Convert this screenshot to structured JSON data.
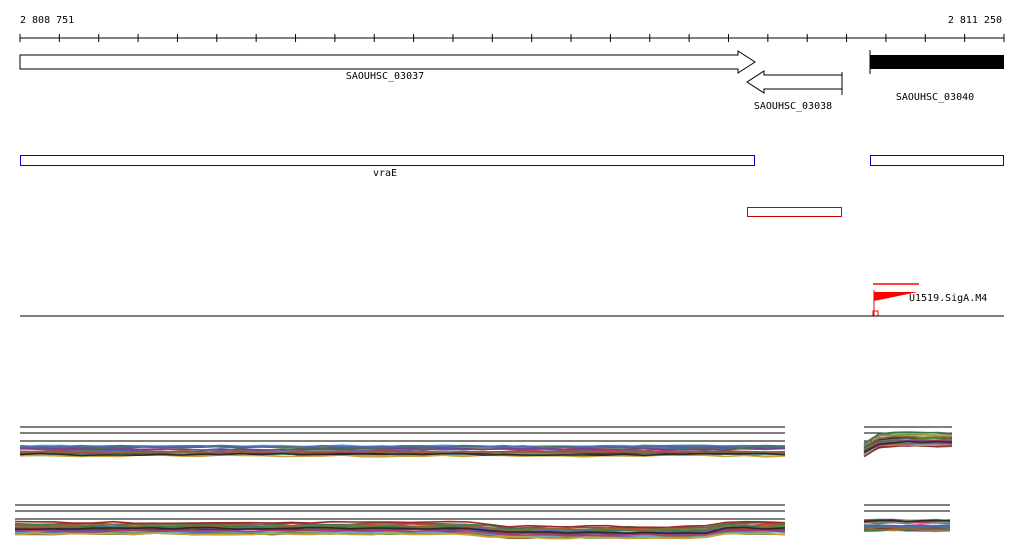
{
  "ruler": {
    "start_label": "2 808 751",
    "end_label": "2 811 250"
  },
  "genes": [
    {
      "label": "SAOUHSC_03037",
      "strand": "+",
      "style": "outline"
    },
    {
      "label": "SAOUHSC_03038",
      "strand": "-",
      "style": "outline"
    },
    {
      "label": "SAOUHSC_03040",
      "strand": "+",
      "style": "filled"
    }
  ],
  "operons": [
    {
      "label": "vraE",
      "color": "#0000cc"
    },
    {
      "label": "",
      "color": "#0000cc"
    },
    {
      "label": "",
      "color": "#cc0000"
    }
  ],
  "promoter": {
    "label": "U1519.SigA.M4",
    "color": "#ff0000"
  },
  "colors": {
    "axis": "#000000",
    "operon_blue": "#0000cc",
    "operon_red": "#cc0000",
    "promoter_red": "#ff0000",
    "expression_palette": [
      "#5fb2c8",
      "#7a9a3c",
      "#c44a2a",
      "#6a4a8c",
      "#c8a43a",
      "#3a7a4a",
      "#b23a6a",
      "#4a6ab2",
      "#8a6a3a",
      "#2a2a2a",
      "#9a2a2a",
      "#5a8a2a"
    ]
  }
}
